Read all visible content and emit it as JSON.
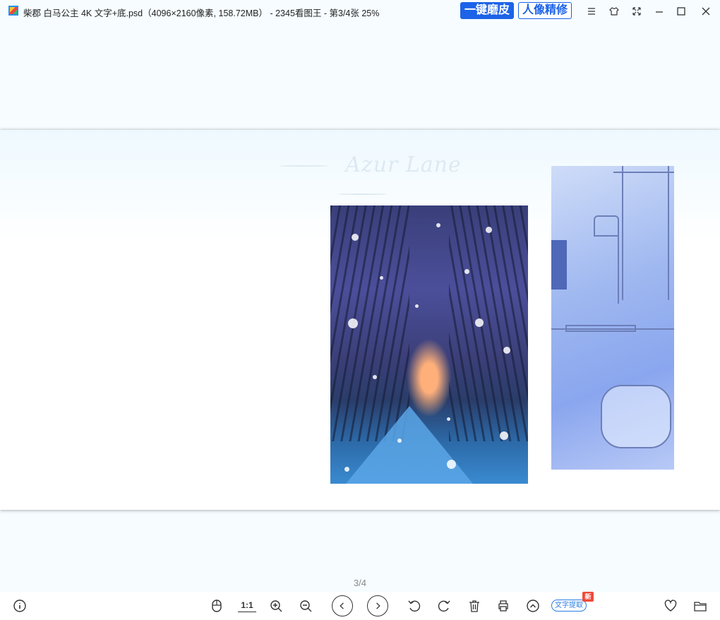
{
  "titlebar": {
    "title": "柴郡 白马公主 4K 文字+底.psd（4096×2160像素, 158.72MB） - 2345看图王 - 第3/4张 25%",
    "smooth_skin_button": "一键磨皮",
    "portrait_button": "人像精修"
  },
  "viewer": {
    "watermark": "Azur Lane",
    "page_counter": "3/4"
  },
  "toolbar": {
    "ratio_label": "1:1",
    "ocr_label": "文字提取",
    "new_badge": "新"
  }
}
